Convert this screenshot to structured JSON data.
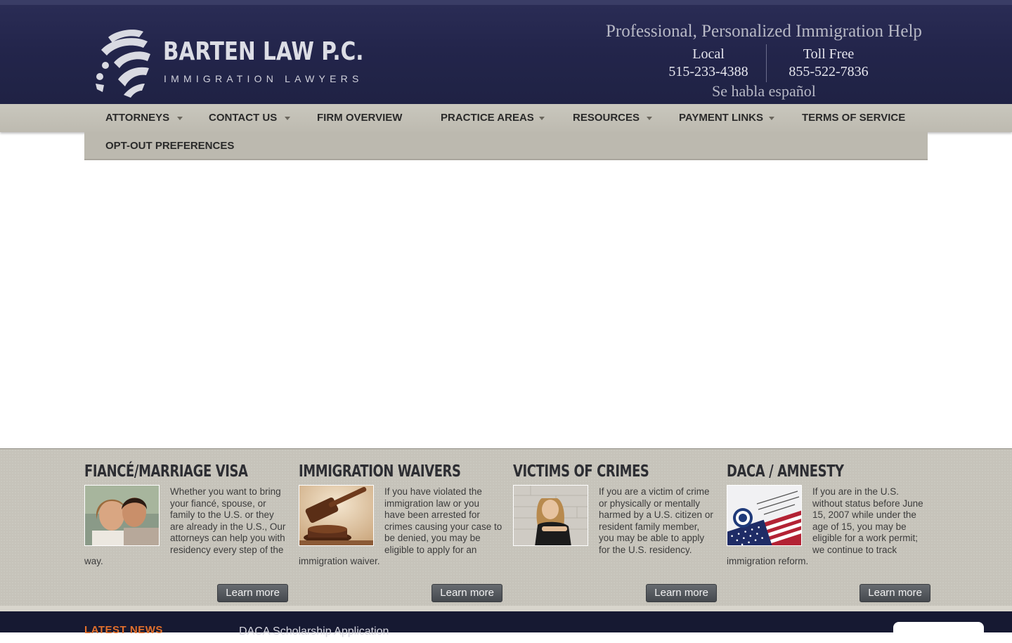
{
  "header": {
    "logo_name": "BARTEN LAW P.C.",
    "logo_sub": "IMMIGRATION LAWYERS",
    "tagline": "Professional, Personalized Immigration Help",
    "local_label": "Local",
    "local_number": "515-233-4388",
    "toll_label": "Toll Free",
    "toll_number": "855-522-7836",
    "spanish": "Se habla español"
  },
  "nav": {
    "items": [
      {
        "label": "ATTORNEYS",
        "has_dropdown": true
      },
      {
        "label": "CONTACT US",
        "has_dropdown": true
      },
      {
        "label": "FIRM OVERVIEW",
        "has_dropdown": false
      },
      {
        "label": "PRACTICE AREAS",
        "has_dropdown": true
      },
      {
        "label": "RESOURCES",
        "has_dropdown": true
      },
      {
        "label": "PAYMENT LINKS",
        "has_dropdown": true
      },
      {
        "label": "TERMS OF SERVICE",
        "has_dropdown": false
      },
      {
        "label": "OPT-OUT PREFERENCES",
        "has_dropdown": false
      }
    ]
  },
  "features": [
    {
      "title": "FIANCÉ/MARRIAGE VISA",
      "text": "Whether you want to bring your fiancé, spouse, or family to the U.S. or they are already in the U.S., Our attorneys can help you with residency every step of the way.",
      "button": "Learn more",
      "image": "couple-photo"
    },
    {
      "title": "IMMIGRATION WAIVERS",
      "text": "If you have violated the immigration law or you have been arrested for crimes causing your case to be denied, you may be eligible to apply for an immigration waiver.",
      "button": "Learn more",
      "image": "gavel-photo"
    },
    {
      "title": "VICTIMS OF CRIMES",
      "text": "If you are a victim of crime or physically or mentally harmed by a U.S. citizen or resident family member, you may be able to apply for the U.S. residency.",
      "button": "Learn more",
      "image": "sad-woman-photo"
    },
    {
      "title": "DACA / AMNESTY",
      "text": "If you are in the U.S. without status before June 15, 2007 while under the age of 15, you may be eligible for a work permit; we continue to track immigration reform.",
      "button": "Learn more",
      "image": "uscis-flag-photo"
    }
  ],
  "footer": {
    "news_heading": "LATEST NEWS",
    "news_item": "DACA Scholarship Application"
  },
  "colors": {
    "header_bg": "#23254b",
    "nav_bg": "#c4c1b7",
    "features_bg": "#c6c3ba",
    "footer_bg": "#161932",
    "news_heading": "#e3702c",
    "button_bg": "#55595e"
  }
}
